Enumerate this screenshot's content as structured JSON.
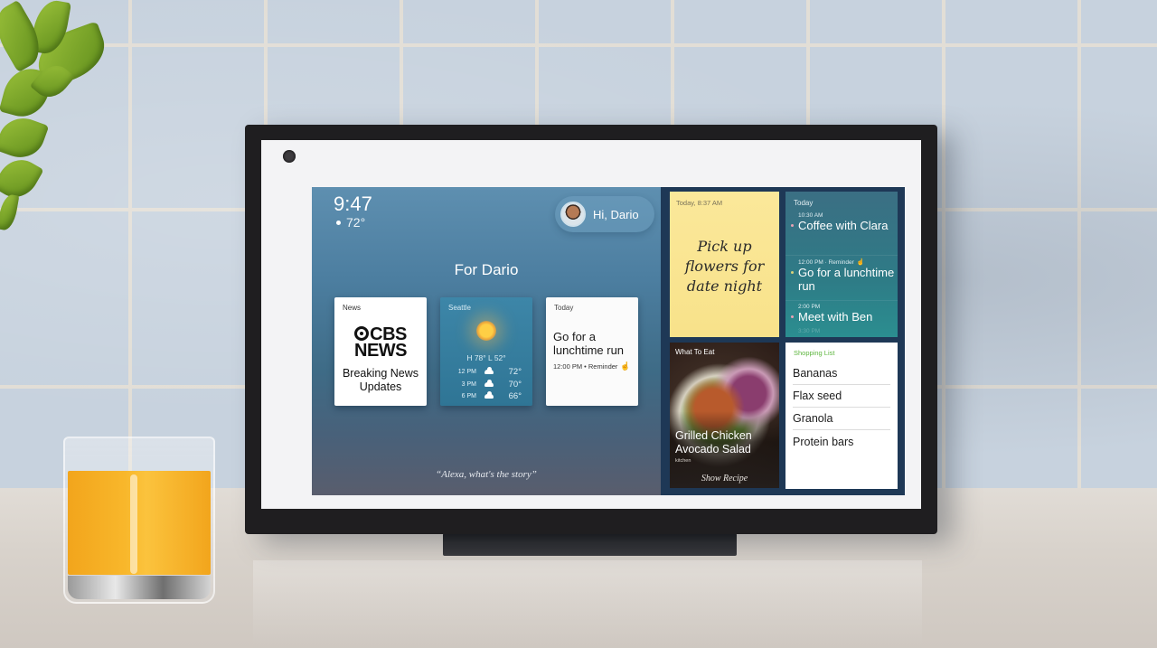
{
  "scene": {
    "colors": {
      "wall": "#c7d2de",
      "grout": "#e6e0d6",
      "counter": "#d8d2cb",
      "device_frame": "#1f1e20",
      "juice": "#f8b72b"
    }
  },
  "status": {
    "time": "9:47",
    "temperature": "72°"
  },
  "greeting": {
    "label": "Hi, Dario"
  },
  "home": {
    "title": "For Dario",
    "prompt": "“Alexa, what's the story”"
  },
  "cards": {
    "news": {
      "label": "News",
      "brand_line1": "CBS",
      "brand_line2": "NEWS",
      "headline": "Breaking News Updates"
    },
    "weather": {
      "label": "Seattle",
      "hilo": "H 78° L 52°",
      "forecast": [
        {
          "time": "12 PM",
          "icon": "cloud-icon",
          "temp": "72°"
        },
        {
          "time": "3 PM",
          "icon": "cloud-icon",
          "temp": "70°"
        },
        {
          "time": "6 PM",
          "icon": "cloud-icon",
          "temp": "66°"
        }
      ]
    },
    "today": {
      "label": "Today",
      "title": "Go for a lunchtime run",
      "meta": "12:00 PM • Reminder"
    }
  },
  "sticky_note": {
    "timestamp": "Today, 8:37 AM",
    "text": "Pick up flowers for date night"
  },
  "agenda": {
    "header": "Today",
    "items": [
      {
        "time": "10:30 AM",
        "title": "Coffee with Clara",
        "dot_color": "#e8a3b5"
      },
      {
        "time": "12:00 PM · Reminder",
        "title": "Go for a lunchtime run",
        "dot_color": "#d9d27a"
      },
      {
        "time": "2:00 PM",
        "title": "Meet with Ben",
        "dot_color": "#e8a3b5"
      }
    ],
    "faded_next": "3:30 PM"
  },
  "recipe": {
    "label": "What To Eat",
    "title": "Grilled Chicken Avocado Salad",
    "source": "kitchen",
    "action": "Show Recipe"
  },
  "shopping_list": {
    "header": "Shopping List",
    "items": [
      "Bananas",
      "Flax seed",
      "Granola",
      "Protein bars"
    ]
  }
}
